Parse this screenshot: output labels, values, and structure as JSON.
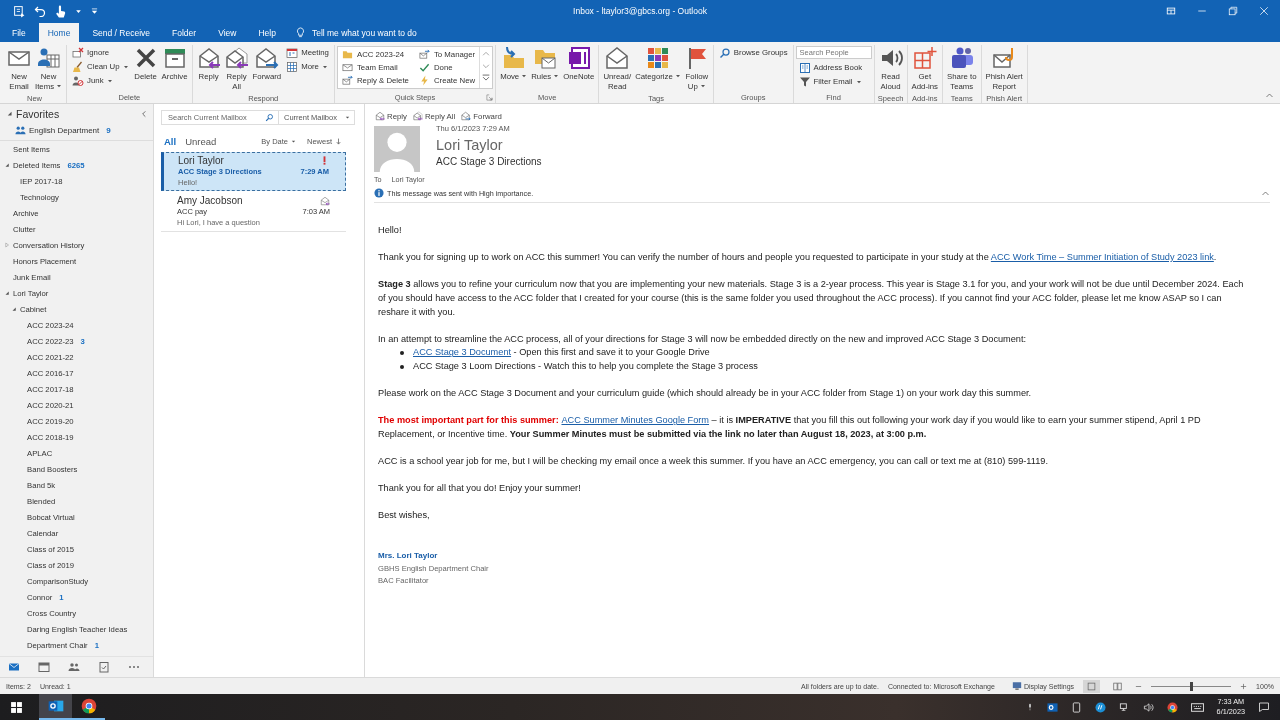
{
  "title_bar": {
    "title": "Inbox - ltaylor3@gbcs.org - Outlook"
  },
  "ribbon_tabs": [
    {
      "label": "File",
      "selected": false
    },
    {
      "label": "Home",
      "selected": true
    },
    {
      "label": "Send / Receive",
      "selected": false
    },
    {
      "label": "Folder",
      "selected": false
    },
    {
      "label": "View",
      "selected": false
    },
    {
      "label": "Help",
      "selected": false
    }
  ],
  "tell_me": "Tell me what you want to do",
  "ribbon_groups": [
    {
      "label": "New",
      "items": [
        {
          "kind": "large",
          "label": "New\nEmail"
        },
        {
          "kind": "large",
          "label": "New\nItems",
          "dropdown": true
        }
      ]
    },
    {
      "label": "Delete",
      "items": [
        {
          "kind": "small",
          "label": "Ignore"
        },
        {
          "kind": "small",
          "label": "Clean Up",
          "dropdown": true
        },
        {
          "kind": "small",
          "label": "Junk",
          "dropdown": true
        },
        {
          "kind": "large",
          "label": "Delete"
        },
        {
          "kind": "large",
          "label": "Archive"
        }
      ]
    },
    {
      "label": "Respond",
      "items": [
        {
          "kind": "large",
          "label": "Reply"
        },
        {
          "kind": "large",
          "label": "Reply\nAll"
        },
        {
          "kind": "large",
          "label": "Forward"
        },
        {
          "kind": "small",
          "label": "Meeting"
        },
        {
          "kind": "small",
          "label": "More",
          "dropdown": true
        }
      ]
    },
    {
      "label": "Quick Steps",
      "launcher": true,
      "items": [
        {
          "kind": "quickstep",
          "label": "ACC 2023-24"
        },
        {
          "kind": "quickstep",
          "label": "To Manager"
        },
        {
          "kind": "quickstep",
          "label": "Team Email"
        },
        {
          "kind": "quickstep",
          "label": "Done"
        },
        {
          "kind": "quickstep",
          "label": "Reply & Delete"
        },
        {
          "kind": "quickstep",
          "label": "Create New"
        }
      ]
    },
    {
      "label": "Move",
      "items": [
        {
          "kind": "large",
          "label": "Move",
          "dropdown": true
        },
        {
          "kind": "large",
          "label": "Rules",
          "dropdown": true
        },
        {
          "kind": "large",
          "label": "OneNote"
        }
      ]
    },
    {
      "label": "Tags",
      "items": [
        {
          "kind": "large",
          "label": "Unread/\nRead"
        },
        {
          "kind": "large",
          "label": "Categorize",
          "dropdown": true
        },
        {
          "kind": "large",
          "label": "Follow\nUp",
          "dropdown": true
        }
      ]
    },
    {
      "label": "Groups",
      "items": [
        {
          "kind": "small",
          "label": "Browse Groups"
        }
      ]
    },
    {
      "label": "Find",
      "items": [
        {
          "kind": "search",
          "placeholder": "Search People"
        },
        {
          "kind": "small",
          "label": "Address Book"
        },
        {
          "kind": "small",
          "label": "Filter Email",
          "dropdown": true
        }
      ]
    },
    {
      "label": "Speech",
      "items": [
        {
          "kind": "large",
          "label": "Read\nAloud"
        }
      ]
    },
    {
      "label": "Add-ins",
      "items": [
        {
          "kind": "large",
          "label": "Get\nAdd-ins"
        }
      ]
    },
    {
      "label": "Teams",
      "items": [
        {
          "kind": "large",
          "label": "Share to\nTeams"
        }
      ]
    },
    {
      "label": "Phish Alert",
      "items": [
        {
          "kind": "large",
          "label": "Phish Alert\nReport"
        }
      ]
    }
  ],
  "folder_pane": {
    "favorites": {
      "label": "Favorites",
      "expanded": true,
      "items": [
        {
          "label": "English Department",
          "count": "9"
        }
      ]
    },
    "folders": [
      {
        "label": "Sent Items"
      },
      {
        "label": "Deleted Items",
        "count": "6265",
        "expanded": true,
        "children": [
          {
            "label": "IEP 2017-18"
          },
          {
            "label": "Technology"
          }
        ]
      },
      {
        "label": "Archive"
      },
      {
        "label": "Clutter"
      },
      {
        "label": "Conversation History",
        "expanded": false
      },
      {
        "label": "Honors Placement"
      },
      {
        "label": "Junk Email"
      },
      {
        "label": "Lori Taylor",
        "expanded": true,
        "children": [
          {
            "label": "Cabinet",
            "expanded": true,
            "children": [
              {
                "label": "ACC 2023-24"
              },
              {
                "label": "ACC 2022-23",
                "count": "3"
              },
              {
                "label": "ACC 2021-22"
              },
              {
                "label": "ACC 2016-17"
              },
              {
                "label": "ACC 2017-18"
              },
              {
                "label": "ACC 2020-21"
              },
              {
                "label": "ACC 2019-20"
              },
              {
                "label": "ACC 2018-19"
              },
              {
                "label": "APLAC"
              },
              {
                "label": "Band Boosters"
              },
              {
                "label": "Band 5k"
              },
              {
                "label": "Blended"
              },
              {
                "label": "Bobcat Virtual"
              },
              {
                "label": "Calendar"
              },
              {
                "label": "Class of 2015"
              },
              {
                "label": "Class of 2019"
              },
              {
                "label": "ComparisonStudy"
              },
              {
                "label": "Connor",
                "count": "1"
              },
              {
                "label": "Cross Country"
              },
              {
                "label": "Daring English Teacher Ideas"
              },
              {
                "label": "Department Chair",
                "count": "1"
              }
            ]
          }
        ]
      }
    ],
    "navigation": [
      {
        "kind": "mail",
        "selected": true
      },
      {
        "kind": "calendar",
        "selected": false
      },
      {
        "kind": "people",
        "selected": false
      },
      {
        "kind": "tasks",
        "selected": false
      },
      {
        "kind": "more",
        "selected": false
      }
    ]
  },
  "message_list": {
    "search": {
      "placeholder": "Search Current Mailbox"
    },
    "scope": "Current Mailbox",
    "filters": [
      {
        "label": "All",
        "selected": true
      },
      {
        "label": "Unread",
        "selected": false
      }
    ],
    "sort": "By Date",
    "order": "Newest",
    "messages": [
      {
        "sender": "Lori Taylor",
        "subject": "ACC Stage 3 Directions",
        "time": "7:29 AM",
        "preview": "Hello!",
        "selected": true,
        "unread": true,
        "high_importance": true,
        "replied": false
      },
      {
        "sender": "Amy Jacobson",
        "subject": "ACC pay",
        "time": "7:03 AM",
        "preview": "Hi Lori,  I have a question",
        "selected": false,
        "unread": false,
        "high_importance": false,
        "replied": true
      }
    ]
  },
  "reading_pane": {
    "actions": [
      "Reply",
      "Reply All",
      "Forward"
    ],
    "date": "Thu 6/1/2023 7:29 AM",
    "sender": "Lori Taylor",
    "subject": "ACC Stage 3 Directions",
    "to_label": "To",
    "to": "Lori Taylor",
    "notice": "This message was sent with High importance.",
    "body": [
      {
        "kind": "paragraph",
        "parts": [
          {
            "kind": "text",
            "text": "Hello!"
          }
        ]
      },
      {
        "kind": "paragraph",
        "parts": [
          {
            "kind": "text",
            "text": "Thank you for signing up to work on ACC this summer! You can verify the number of hours and people you requested to participate in your study at the "
          },
          {
            "kind": "link",
            "text": "ACC Work Time – Summer Initiation of Study 2023 link"
          },
          {
            "kind": "text",
            "text": "."
          }
        ]
      },
      {
        "kind": "paragraph",
        "parts": [
          {
            "kind": "text",
            "text": "**Stage 3** allows you to refine your curriculum now that you are implementing your new materials. Stage 3 is a 2-year process. This year is Stage 3.1 for you, and your work will not be due until December 2024. Each of you should have access to the ACC folder that I created for your course (this is the same folder you used throughout the ACC process). If you cannot find your ACC folder, please let me know ASAP so I can reshare it with you."
          }
        ]
      },
      {
        "kind": "lead",
        "parts": [
          {
            "kind": "text",
            "text": "In an attempt to streamline the ACC process, all of your directions for Stage 3 will now be embedded directly on the new and improved ACC Stage 3 Document:"
          }
        ]
      },
      {
        "kind": "bullets",
        "items": [
          {
            "parts": [
              {
                "kind": "link",
                "text": "ACC Stage 3 Document"
              },
              {
                "kind": "text",
                "text": " - Open this first and save it to your Google Drive"
              }
            ]
          },
          {
            "parts": [
              {
                "kind": "text",
                "text": "ACC Stage 3 Loom Directions - Watch this to help you complete the Stage 3 process"
              }
            ]
          }
        ]
      },
      {
        "kind": "paragraph",
        "parts": [
          {
            "kind": "text",
            "text": "Please work on the ACC Stage 3 Document and your curriculum guide (which should already be in your ACC folder from Stage 1) on your work day this summer."
          }
        ]
      },
      {
        "kind": "paragraph",
        "parts": [
          {
            "kind": "alert",
            "text": "The most important part for this summer:"
          },
          {
            "kind": "link",
            "text": "ACC Summer Minutes Google Form"
          },
          {
            "kind": "text",
            "text": " – it is **IMPERATIVE** that you fill this out following your work day if you would like to earn your summer stipend, April 1 PD Replacement, or Incentive time. **Your Summer Minutes must be submitted via the link no later than August 18, 2023, at 3:00 p.m.**"
          }
        ]
      },
      {
        "kind": "paragraph",
        "parts": [
          {
            "kind": "text",
            "text": "ACC is a school year job for me, but I will be checking my email once a week this summer. If you have an ACC emergency, you can call or text me at (810) 599-1119."
          }
        ]
      },
      {
        "kind": "paragraph",
        "parts": [
          {
            "kind": "text",
            "text": "Thank you for all that you do! Enjoy your summer!"
          }
        ]
      },
      {
        "kind": "closing",
        "parts": [
          {
            "kind": "text",
            "text": "Best wishes,"
          }
        ]
      },
      {
        "kind": "signature",
        "lines": [
          {
            "kind": "name",
            "text": "Mrs. Lori Taylor"
          },
          {
            "kind": "title",
            "text": "GBHS English Department Chair"
          },
          {
            "kind": "title",
            "text": "BAC Facilitator"
          }
        ]
      }
    ]
  },
  "status_bar": {
    "items": "Items: 2",
    "unread": "Unread: 1",
    "sync": "All folders are up to date.",
    "connection": "Connected to: Microsoft Exchange",
    "display_settings": "Display Settings",
    "views": [
      {
        "kind": "normal",
        "selected": true
      },
      {
        "kind": "reading",
        "selected": false
      }
    ],
    "zoom": {
      "level": 0.5,
      "reading": "100%"
    }
  },
  "taskbar": {
    "apps": [
      {
        "kind": "mail",
        "selected": true
      },
      {
        "kind": "browser",
        "selected": false
      }
    ],
    "time": "7:33 AM",
    "date": "6/1/2023"
  }
}
